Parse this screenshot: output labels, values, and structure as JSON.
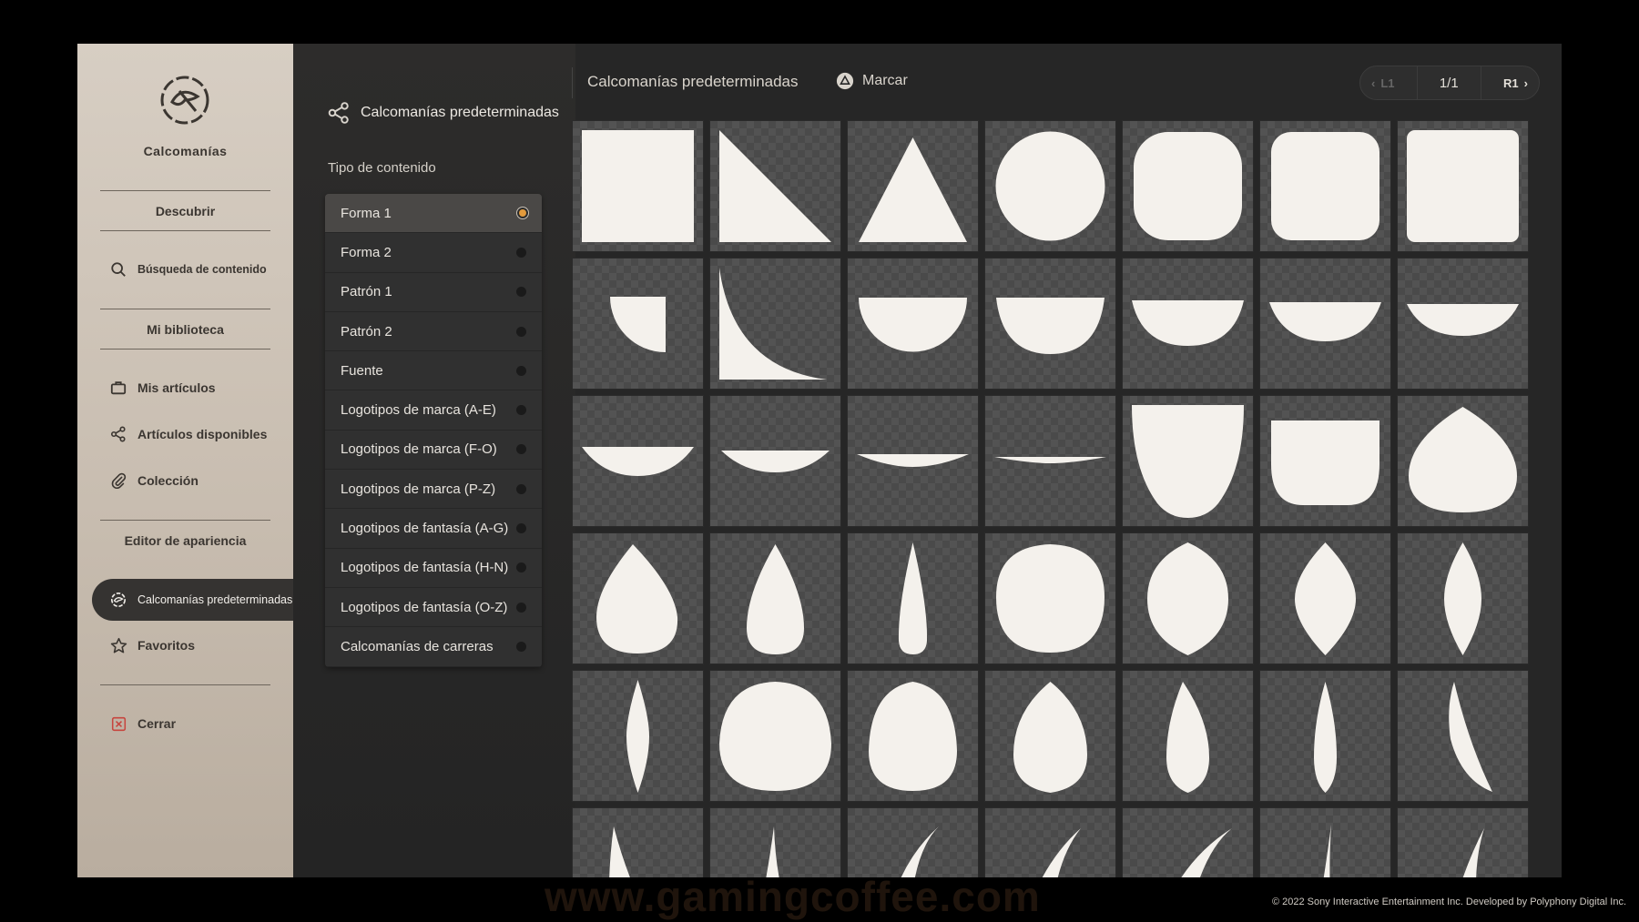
{
  "sidebar": {
    "app_title": "Calcomanías",
    "sections": {
      "discover": "Descubrir",
      "library": "Mi biblioteca",
      "editor": "Editor de apariencia"
    },
    "items": {
      "search": "Búsqueda de contenido",
      "my_items": "Mis artículos",
      "available": "Artículos disponibles",
      "collection": "Colección",
      "preset_decals": "Calcomanías predeterminadas",
      "favorites": "Favoritos",
      "close": "Cerrar"
    }
  },
  "panel": {
    "header": "Calcomanías predeterminadas",
    "subtitle": "Tipo de contenido",
    "content_types": [
      "Forma 1",
      "Forma 2",
      "Patrón 1",
      "Patrón 2",
      "Fuente",
      "Logotipos de marca (A-E)",
      "Logotipos de marca (F-O)",
      "Logotipos de marca (P-Z)",
      "Logotipos de fantasía (A-G)",
      "Logotipos de fantasía (H-N)",
      "Logotipos de fantasía (O-Z)",
      "Calcomanías de carreras"
    ],
    "selected_index": 0
  },
  "topbar": {
    "title": "Calcomanías predeterminadas",
    "mark_label": "Marcar",
    "page": "1/1",
    "prev_label": "L1",
    "next_label": "R1"
  },
  "grid": {
    "shapes": [
      "square",
      "right-triangle",
      "triangle",
      "circle",
      "rounded-square",
      "rounded-square-2",
      "rounded-square-3",
      "quarter-circle",
      "concave-corner",
      "half-circle",
      "segment-large",
      "segment-medium",
      "segment-small",
      "segment-smaller",
      "lens-wide",
      "lens-medium",
      "lens-thin",
      "lens-thinnest",
      "shield-deep",
      "shield-shallow",
      "onion",
      "drop-round",
      "drop-medium",
      "drop-thin",
      "circle-flat",
      "lemon",
      "leaf-wide",
      "leaf-thin",
      "needle-leaf",
      "egg-wide",
      "egg-medium",
      "drop-egg",
      "drop-slim",
      "needle-slim",
      "crescent-blade",
      "fang-1",
      "fang-2",
      "hook-1",
      "hook-2",
      "hook-3",
      "spike",
      "hook-4"
    ]
  },
  "colors": {
    "accent": "#e29a3c",
    "shape_fill": "#f4f1ec",
    "sidebar_bg": "#cfc6bb"
  },
  "footer": {
    "copyright": "© 2022 Sony Interactive Entertainment Inc. Developed by Polyphony Digital Inc.",
    "watermark": "www.gamingcoffee.com"
  }
}
